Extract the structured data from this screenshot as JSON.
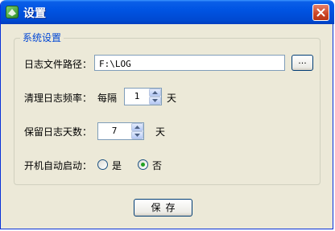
{
  "window": {
    "title": "设置",
    "close_label": "close"
  },
  "group": {
    "title": "系统设置"
  },
  "log_path": {
    "label": "日志文件路径：",
    "value": "F:\\LOG",
    "browse_label": "..."
  },
  "clean_freq": {
    "label": "清理日志频率：",
    "prefix": "每隔",
    "value": "1",
    "unit": "天"
  },
  "keep_days": {
    "label": "保留日志天数：",
    "value": "7",
    "unit": "天"
  },
  "autostart": {
    "label": "开机自动启动：",
    "options": [
      {
        "label": "是",
        "selected": false
      },
      {
        "label": "否",
        "selected": true
      }
    ]
  },
  "footer": {
    "save_label": "保存"
  },
  "colors": {
    "titlebar": "#0054e3",
    "face": "#ece9d8",
    "group_title": "#0046d5",
    "radio_dot": "#21a121"
  }
}
